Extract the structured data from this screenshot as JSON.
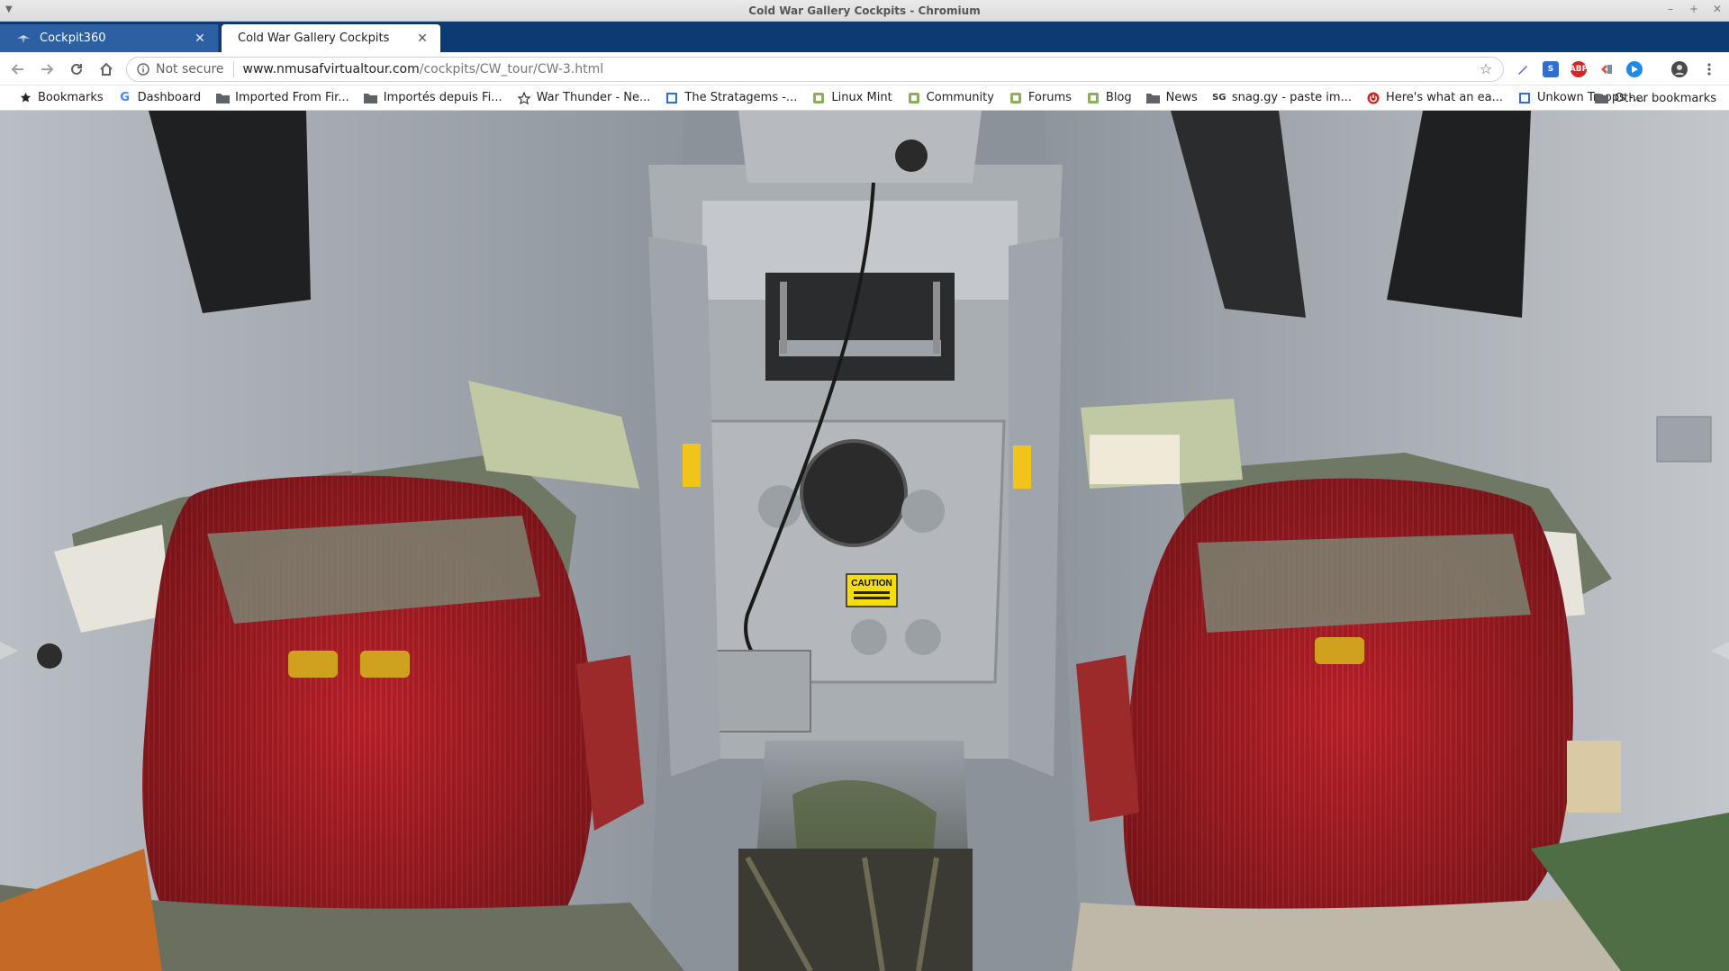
{
  "window": {
    "title": "Cold War Gallery Cockpits - Chromium"
  },
  "tabs": [
    {
      "label": "Cockpit360",
      "active": false,
      "icon": "cockpit360-favicon"
    },
    {
      "label": "Cold War Gallery Cockpits",
      "active": true,
      "icon": "none"
    }
  ],
  "toolbar": {
    "security_label": "Not secure",
    "url_host": "www.nmusafvirtualtour.com",
    "url_path": "/cockpits/CW_tour/CW-3.html"
  },
  "extensions": [
    "pen-icon",
    "s-extension-icon",
    "adblock-plus-icon",
    "puzzle-extension-icon",
    "play-extension-icon",
    "profile-avatar"
  ],
  "bookmarks": [
    {
      "label": "Bookmarks",
      "icon": "star-icon"
    },
    {
      "label": "Dashboard",
      "icon": "google-icon"
    },
    {
      "label": "Imported From Fir...",
      "icon": "folder-icon"
    },
    {
      "label": "Importés depuis Fi...",
      "icon": "folder-icon"
    },
    {
      "label": "War Thunder - Ne...",
      "icon": "war-thunder-icon"
    },
    {
      "label": "The Stratagems -...",
      "icon": "page-icon"
    },
    {
      "label": "Linux Mint",
      "icon": "mint-icon"
    },
    {
      "label": "Community",
      "icon": "mint-icon"
    },
    {
      "label": "Forums",
      "icon": "mint-icon"
    },
    {
      "label": "Blog",
      "icon": "mint-icon"
    },
    {
      "label": "News",
      "icon": "folder-icon"
    },
    {
      "label": "snag.gy - paste im...",
      "icon": "snaggy-icon"
    },
    {
      "label": "Here's what an ea...",
      "icon": "power-icon"
    },
    {
      "label": "Unkown Troops -...",
      "icon": "page-icon"
    }
  ],
  "bookmarks_other": "Other bookmarks",
  "panorama": {
    "caution_label": "CAUTION"
  },
  "colors": {
    "tabstrip": "#0d3a73",
    "seat_red": "#b41e26",
    "caution_yellow": "#f3dc12"
  }
}
